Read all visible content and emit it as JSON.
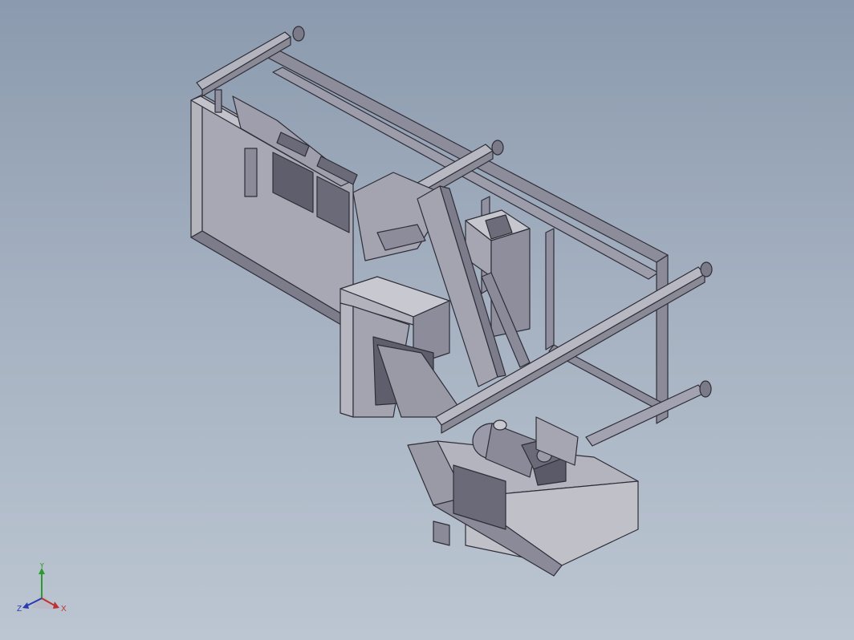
{
  "viewport": {
    "background_top": "#8b9aae",
    "background_bottom": "#bcc6d2"
  },
  "model": {
    "part_fill": "#9a9aa8",
    "part_dark": "#6e6e7c",
    "part_light": "#c4c4cc",
    "edge_color": "#2e2e38"
  },
  "triad": {
    "x_label": "X",
    "y_label": "Y",
    "z_label": "Z",
    "x_color": "#c03030",
    "y_color": "#2e9a2e",
    "z_color": "#2a3ab0"
  }
}
